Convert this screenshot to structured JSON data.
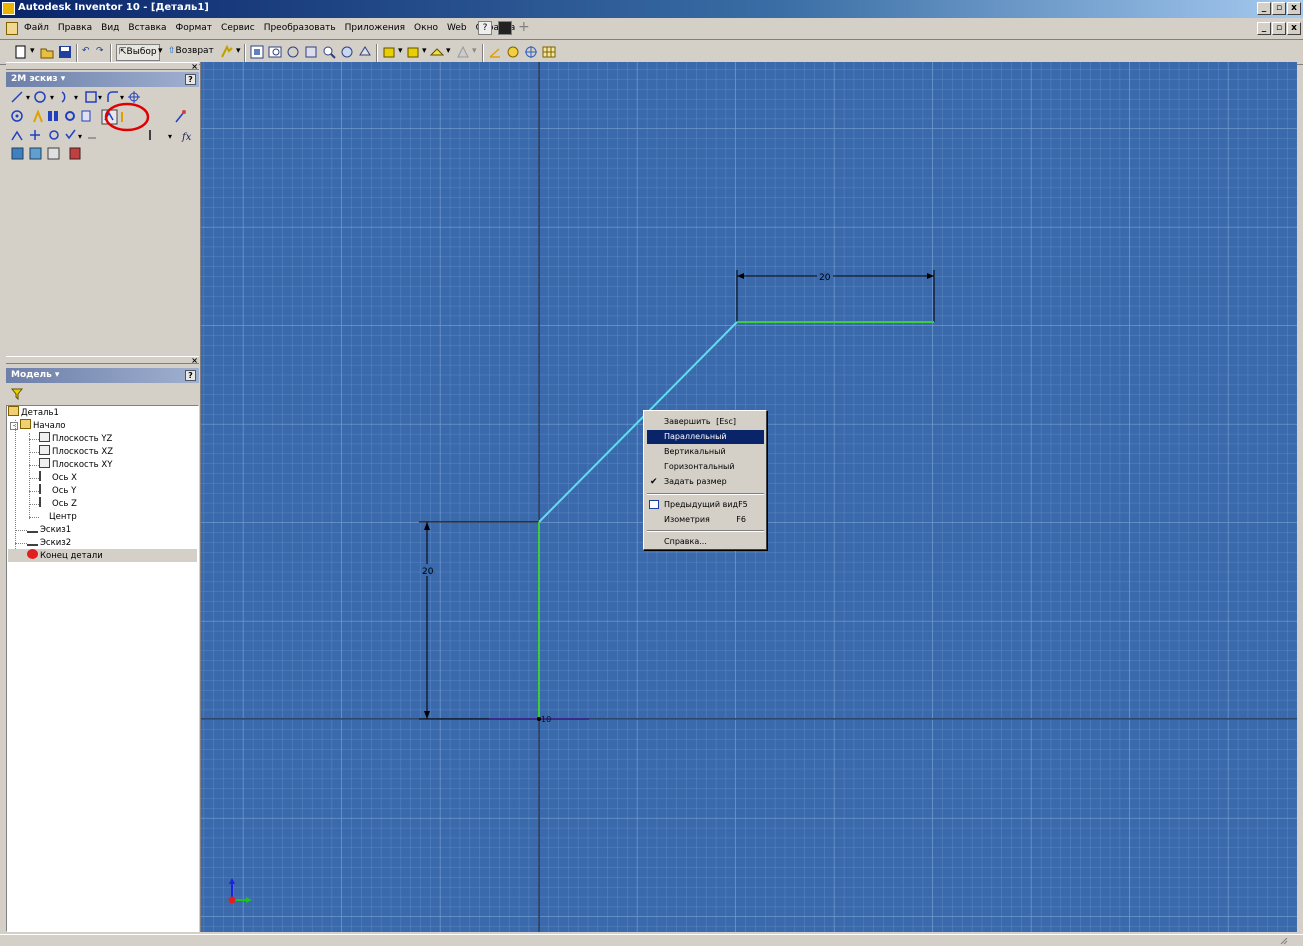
{
  "window": {
    "title": "Autodesk Inventor 10 - [Деталь1]",
    "min_glyph": "_",
    "restore_glyph": "▫",
    "close_glyph": "x"
  },
  "menu": {
    "items": [
      "Файл",
      "Правка",
      "Вид",
      "Вставка",
      "Формат",
      "Сервис",
      "Преобразовать",
      "Приложения",
      "Окно",
      "Web",
      "Справка"
    ]
  },
  "toolbar": {
    "select_label": "Выбор",
    "return_label": "Возврат"
  },
  "sketch_panel": {
    "title": "2М эскиз",
    "close_glyph": "×",
    "help_glyph": "?"
  },
  "model_panel": {
    "title": "Модель",
    "close_glyph": "×",
    "help_glyph": "?",
    "tree": [
      {
        "label": "Деталь1"
      },
      {
        "label": "Начало"
      },
      {
        "label": "Плоскость YZ"
      },
      {
        "label": "Плоскость XZ"
      },
      {
        "label": "Плоскость XY"
      },
      {
        "label": "Ось X"
      },
      {
        "label": "Ось Y"
      },
      {
        "label": "Ось Z"
      },
      {
        "label": "Центр"
      },
      {
        "label": "Эскиз1"
      },
      {
        "label": "Эскиз2"
      },
      {
        "label": "Конец детали"
      }
    ]
  },
  "sketch": {
    "dim_horizontal": "20",
    "dim_vertical": "20",
    "origin_label": "10"
  },
  "context_menu": {
    "items": [
      {
        "label": "Завершить",
        "shortcut": "[Esc]"
      },
      {
        "label": "Параллельный"
      },
      {
        "label": "Вертикальный"
      },
      {
        "label": "Горизонтальный"
      },
      {
        "label": "Задать размер",
        "checked": true
      },
      {
        "label": "Предыдущий вид",
        "shortcut": "F5"
      },
      {
        "label": "Изометрия",
        "shortcut": "F6"
      },
      {
        "label": "Справка..."
      }
    ]
  },
  "colors": {
    "canvas_bg": "#3a69ac",
    "grid_minor": "#5a86c2",
    "grid_major": "#7aa0d4",
    "sketch_line_cyan": "#5fdcf0",
    "sketch_line_green": "#3ccc3c",
    "highlight_circle": "#e00000"
  }
}
